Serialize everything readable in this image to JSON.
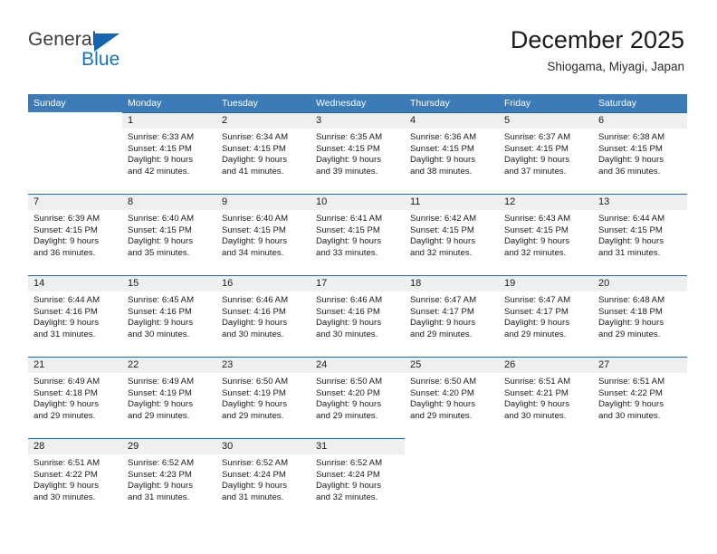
{
  "brand": {
    "name_part1": "General",
    "name_part2": "Blue",
    "triangle_icon": "blue-triangle-icon",
    "color_dark": "#3c3c3c",
    "color_blue": "#1772c0"
  },
  "header": {
    "title": "December 2025",
    "subtitle": "Shiogama, Miyagi, Japan"
  },
  "theme": {
    "header_blue": "#3b7cb8",
    "row_border_blue": "#1f6bb0",
    "day_band_gray": "#efefef"
  },
  "weekdays": [
    "Sunday",
    "Monday",
    "Tuesday",
    "Wednesday",
    "Thursday",
    "Friday",
    "Saturday"
  ],
  "weeks": [
    [
      {
        "day": "",
        "sunrise": "",
        "sunset": "",
        "daylight_line1": "",
        "daylight_line2": ""
      },
      {
        "day": "1",
        "sunrise": "Sunrise: 6:33 AM",
        "sunset": "Sunset: 4:15 PM",
        "daylight_line1": "Daylight: 9 hours",
        "daylight_line2": "and 42 minutes."
      },
      {
        "day": "2",
        "sunrise": "Sunrise: 6:34 AM",
        "sunset": "Sunset: 4:15 PM",
        "daylight_line1": "Daylight: 9 hours",
        "daylight_line2": "and 41 minutes."
      },
      {
        "day": "3",
        "sunrise": "Sunrise: 6:35 AM",
        "sunset": "Sunset: 4:15 PM",
        "daylight_line1": "Daylight: 9 hours",
        "daylight_line2": "and 39 minutes."
      },
      {
        "day": "4",
        "sunrise": "Sunrise: 6:36 AM",
        "sunset": "Sunset: 4:15 PM",
        "daylight_line1": "Daylight: 9 hours",
        "daylight_line2": "and 38 minutes."
      },
      {
        "day": "5",
        "sunrise": "Sunrise: 6:37 AM",
        "sunset": "Sunset: 4:15 PM",
        "daylight_line1": "Daylight: 9 hours",
        "daylight_line2": "and 37 minutes."
      },
      {
        "day": "6",
        "sunrise": "Sunrise: 6:38 AM",
        "sunset": "Sunset: 4:15 PM",
        "daylight_line1": "Daylight: 9 hours",
        "daylight_line2": "and 36 minutes."
      }
    ],
    [
      {
        "day": "7",
        "sunrise": "Sunrise: 6:39 AM",
        "sunset": "Sunset: 4:15 PM",
        "daylight_line1": "Daylight: 9 hours",
        "daylight_line2": "and 36 minutes."
      },
      {
        "day": "8",
        "sunrise": "Sunrise: 6:40 AM",
        "sunset": "Sunset: 4:15 PM",
        "daylight_line1": "Daylight: 9 hours",
        "daylight_line2": "and 35 minutes."
      },
      {
        "day": "9",
        "sunrise": "Sunrise: 6:40 AM",
        "sunset": "Sunset: 4:15 PM",
        "daylight_line1": "Daylight: 9 hours",
        "daylight_line2": "and 34 minutes."
      },
      {
        "day": "10",
        "sunrise": "Sunrise: 6:41 AM",
        "sunset": "Sunset: 4:15 PM",
        "daylight_line1": "Daylight: 9 hours",
        "daylight_line2": "and 33 minutes."
      },
      {
        "day": "11",
        "sunrise": "Sunrise: 6:42 AM",
        "sunset": "Sunset: 4:15 PM",
        "daylight_line1": "Daylight: 9 hours",
        "daylight_line2": "and 32 minutes."
      },
      {
        "day": "12",
        "sunrise": "Sunrise: 6:43 AM",
        "sunset": "Sunset: 4:15 PM",
        "daylight_line1": "Daylight: 9 hours",
        "daylight_line2": "and 32 minutes."
      },
      {
        "day": "13",
        "sunrise": "Sunrise: 6:44 AM",
        "sunset": "Sunset: 4:15 PM",
        "daylight_line1": "Daylight: 9 hours",
        "daylight_line2": "and 31 minutes."
      }
    ],
    [
      {
        "day": "14",
        "sunrise": "Sunrise: 6:44 AM",
        "sunset": "Sunset: 4:16 PM",
        "daylight_line1": "Daylight: 9 hours",
        "daylight_line2": "and 31 minutes."
      },
      {
        "day": "15",
        "sunrise": "Sunrise: 6:45 AM",
        "sunset": "Sunset: 4:16 PM",
        "daylight_line1": "Daylight: 9 hours",
        "daylight_line2": "and 30 minutes."
      },
      {
        "day": "16",
        "sunrise": "Sunrise: 6:46 AM",
        "sunset": "Sunset: 4:16 PM",
        "daylight_line1": "Daylight: 9 hours",
        "daylight_line2": "and 30 minutes."
      },
      {
        "day": "17",
        "sunrise": "Sunrise: 6:46 AM",
        "sunset": "Sunset: 4:16 PM",
        "daylight_line1": "Daylight: 9 hours",
        "daylight_line2": "and 30 minutes."
      },
      {
        "day": "18",
        "sunrise": "Sunrise: 6:47 AM",
        "sunset": "Sunset: 4:17 PM",
        "daylight_line1": "Daylight: 9 hours",
        "daylight_line2": "and 29 minutes."
      },
      {
        "day": "19",
        "sunrise": "Sunrise: 6:47 AM",
        "sunset": "Sunset: 4:17 PM",
        "daylight_line1": "Daylight: 9 hours",
        "daylight_line2": "and 29 minutes."
      },
      {
        "day": "20",
        "sunrise": "Sunrise: 6:48 AM",
        "sunset": "Sunset: 4:18 PM",
        "daylight_line1": "Daylight: 9 hours",
        "daylight_line2": "and 29 minutes."
      }
    ],
    [
      {
        "day": "21",
        "sunrise": "Sunrise: 6:49 AM",
        "sunset": "Sunset: 4:18 PM",
        "daylight_line1": "Daylight: 9 hours",
        "daylight_line2": "and 29 minutes."
      },
      {
        "day": "22",
        "sunrise": "Sunrise: 6:49 AM",
        "sunset": "Sunset: 4:19 PM",
        "daylight_line1": "Daylight: 9 hours",
        "daylight_line2": "and 29 minutes."
      },
      {
        "day": "23",
        "sunrise": "Sunrise: 6:50 AM",
        "sunset": "Sunset: 4:19 PM",
        "daylight_line1": "Daylight: 9 hours",
        "daylight_line2": "and 29 minutes."
      },
      {
        "day": "24",
        "sunrise": "Sunrise: 6:50 AM",
        "sunset": "Sunset: 4:20 PM",
        "daylight_line1": "Daylight: 9 hours",
        "daylight_line2": "and 29 minutes."
      },
      {
        "day": "25",
        "sunrise": "Sunrise: 6:50 AM",
        "sunset": "Sunset: 4:20 PM",
        "daylight_line1": "Daylight: 9 hours",
        "daylight_line2": "and 29 minutes."
      },
      {
        "day": "26",
        "sunrise": "Sunrise: 6:51 AM",
        "sunset": "Sunset: 4:21 PM",
        "daylight_line1": "Daylight: 9 hours",
        "daylight_line2": "and 30 minutes."
      },
      {
        "day": "27",
        "sunrise": "Sunrise: 6:51 AM",
        "sunset": "Sunset: 4:22 PM",
        "daylight_line1": "Daylight: 9 hours",
        "daylight_line2": "and 30 minutes."
      }
    ],
    [
      {
        "day": "28",
        "sunrise": "Sunrise: 6:51 AM",
        "sunset": "Sunset: 4:22 PM",
        "daylight_line1": "Daylight: 9 hours",
        "daylight_line2": "and 30 minutes."
      },
      {
        "day": "29",
        "sunrise": "Sunrise: 6:52 AM",
        "sunset": "Sunset: 4:23 PM",
        "daylight_line1": "Daylight: 9 hours",
        "daylight_line2": "and 31 minutes."
      },
      {
        "day": "30",
        "sunrise": "Sunrise: 6:52 AM",
        "sunset": "Sunset: 4:24 PM",
        "daylight_line1": "Daylight: 9 hours",
        "daylight_line2": "and 31 minutes."
      },
      {
        "day": "31",
        "sunrise": "Sunrise: 6:52 AM",
        "sunset": "Sunset: 4:24 PM",
        "daylight_line1": "Daylight: 9 hours",
        "daylight_line2": "and 32 minutes."
      },
      {
        "day": "",
        "sunrise": "",
        "sunset": "",
        "daylight_line1": "",
        "daylight_line2": ""
      },
      {
        "day": "",
        "sunrise": "",
        "sunset": "",
        "daylight_line1": "",
        "daylight_line2": ""
      },
      {
        "day": "",
        "sunrise": "",
        "sunset": "",
        "daylight_line1": "",
        "daylight_line2": ""
      }
    ]
  ]
}
